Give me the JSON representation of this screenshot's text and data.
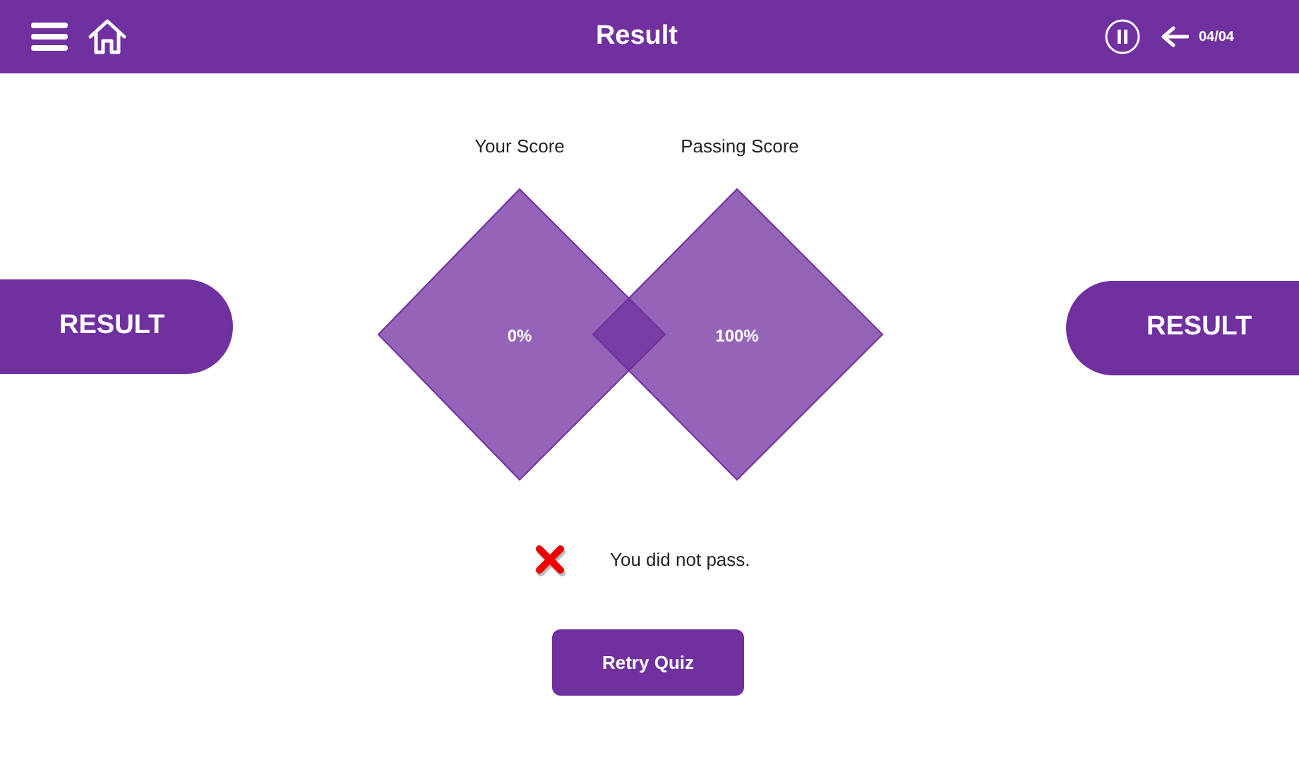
{
  "header": {
    "title": "Result",
    "progress": "04/04"
  },
  "side_labels": [
    "RESULT",
    "RESULT"
  ],
  "scores": [
    {
      "label": "Your Score",
      "value": "0%"
    },
    {
      "label": "Passing Score",
      "value": "100%"
    }
  ],
  "result": {
    "passed": false,
    "message": "You did not pass."
  },
  "retry_button": "Retry Quiz"
}
